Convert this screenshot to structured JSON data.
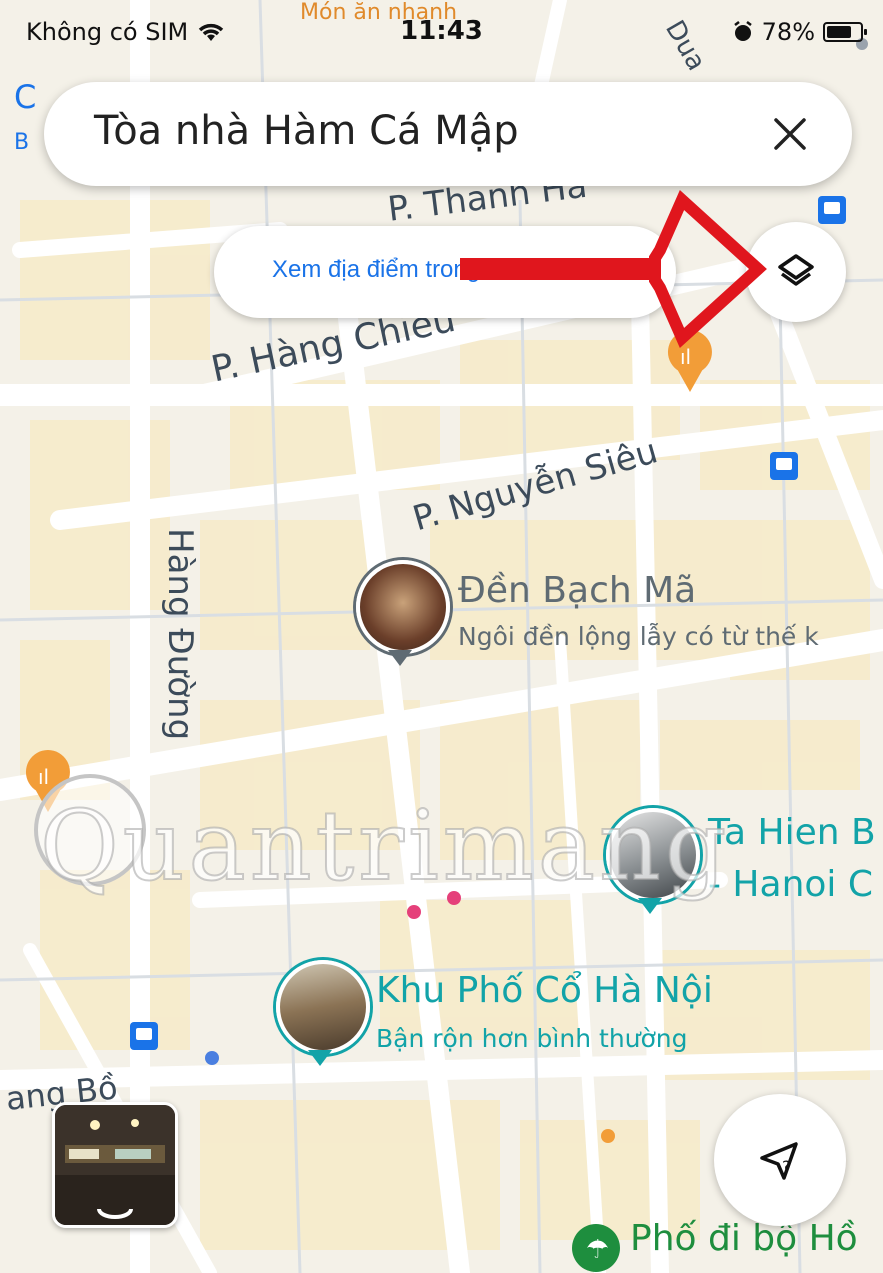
{
  "status": {
    "carrier": "Không có SIM",
    "time": "11:43",
    "battery": "78%"
  },
  "search": {
    "query": "Tòa nhà Hàm Cá Mập"
  },
  "map_action": {
    "label": "Xem địa điểm trong"
  },
  "roads": {
    "thanh_ha": "P. Thanh Hà",
    "hang_chieu": "P. Hàng Chiếu",
    "nguyen_sieu": "P. Nguyễn Siêu",
    "hang_duong": "Hàng Đường",
    "hang_bo": "ang Bồ",
    "top_fragment": "Món ăn nhanh",
    "top_right_fragment": "Dua",
    "left_fragment_1": "C",
    "left_fragment_2": "B"
  },
  "places": [
    {
      "title": "Đền Bạch Mã",
      "subtitle": "Ngôi đền lộng lẫy có từ thế k",
      "color": "#5f6b73"
    },
    {
      "title": "Ta Hien B",
      "subtitle": "- Hanoi C",
      "color": "#12a3a8"
    },
    {
      "title": "Khu Phố Cổ Hà Nội",
      "subtitle": "Bận rộn hơn bình thường",
      "color": "#12a3a8"
    },
    {
      "title": "Phố đi bộ Hồ",
      "subtitle": "",
      "color": "#1e8e3e"
    }
  ],
  "watermark": "Quantrimang",
  "colors": {
    "accent": "#1a73e8",
    "arrow": "#e0161d",
    "food_pin": "#f29d38"
  },
  "icons": {
    "close": "close-icon",
    "layers": "layers-icon",
    "location": "location-arrow-icon",
    "food": "restaurant-pin-icon",
    "bus": "bus-stop-icon"
  }
}
